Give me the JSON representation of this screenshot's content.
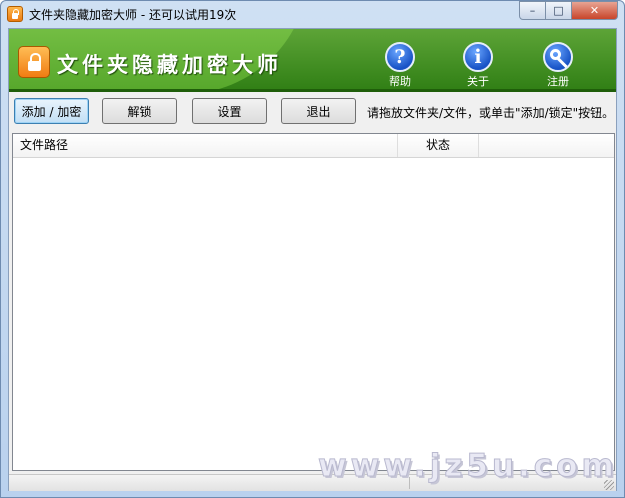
{
  "window": {
    "title": "文件夹隐藏加密大师 - 还可以试用19次",
    "min_symbol": "–",
    "max_symbol": "□",
    "close_symbol": "✕"
  },
  "banner": {
    "brand": "文件夹隐藏加密大师",
    "tools": [
      {
        "label": "帮助",
        "glyph": "?"
      },
      {
        "label": "关于",
        "glyph": "i"
      },
      {
        "label": "注册",
        "glyph": ""
      }
    ]
  },
  "toolbar": {
    "add_lock": "添加 / 加密",
    "unlock": "解锁",
    "settings": "设置",
    "exit": "退出",
    "hint": "请拖放文件夹/文件，或单击\"添加/锁定\"按钮。"
  },
  "list": {
    "columns": [
      "文件路径",
      "状态",
      ""
    ],
    "rows": []
  },
  "watermark": "www.jz5u.com",
  "colors": {
    "banner_green": "#3f9020",
    "accent_blue": "#1853c6",
    "lock_orange": "#f07c12"
  }
}
